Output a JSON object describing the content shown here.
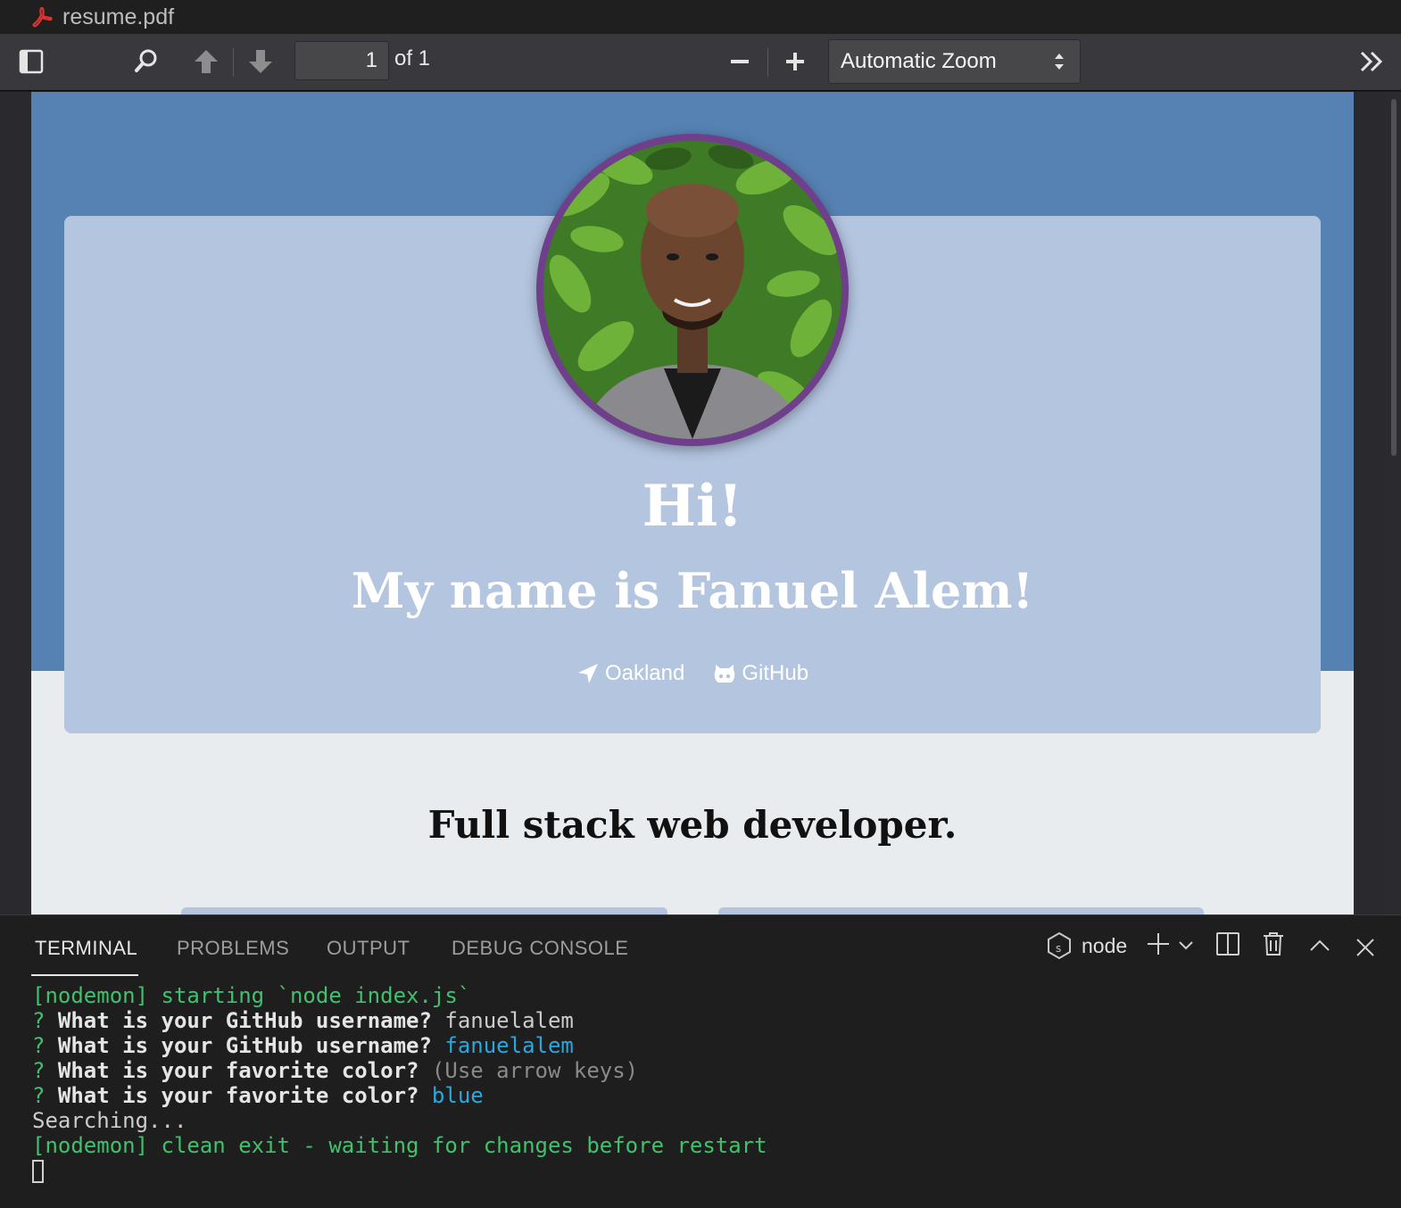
{
  "window": {
    "title": "resume.pdf"
  },
  "toolbar": {
    "page_number": "1",
    "page_of": "of 1",
    "zoom_value": "Automatic Zoom"
  },
  "resume": {
    "greeting": "Hi!",
    "name_line": "My name is Fanuel Alem!",
    "location": "Oakland",
    "github_label": "GitHub",
    "subtitle": "Full stack web developer.",
    "accent_colors": {
      "header_band": "#5682b3",
      "card": "#b4c5e0",
      "avatar_border": "#6f3f8c"
    }
  },
  "panel": {
    "tabs": [
      {
        "label": "TERMINAL",
        "active": true
      },
      {
        "label": "PROBLEMS",
        "active": false
      },
      {
        "label": "OUTPUT",
        "active": false
      },
      {
        "label": "DEBUG CONSOLE",
        "active": false
      }
    ],
    "shell_name": "node"
  },
  "terminal": {
    "line1": {
      "text": "[nodemon] starting `node index.js`"
    },
    "line2": {
      "q": "? ",
      "prompt": "What is your GitHub username?",
      "answer": " fanuelalem"
    },
    "line3": {
      "q": "? ",
      "prompt": "What is your GitHub username?",
      "answer": " fanuelalem"
    },
    "line4": {
      "q": "? ",
      "prompt": "What is your favorite color?",
      "hint": " (Use arrow keys)"
    },
    "line5": {
      "q": "? ",
      "prompt": "What is your favorite color?",
      "answer": " blue"
    },
    "line6": {
      "text": "Searching..."
    },
    "line7": {
      "text": "[nodemon] clean exit - waiting for changes before restart"
    }
  }
}
